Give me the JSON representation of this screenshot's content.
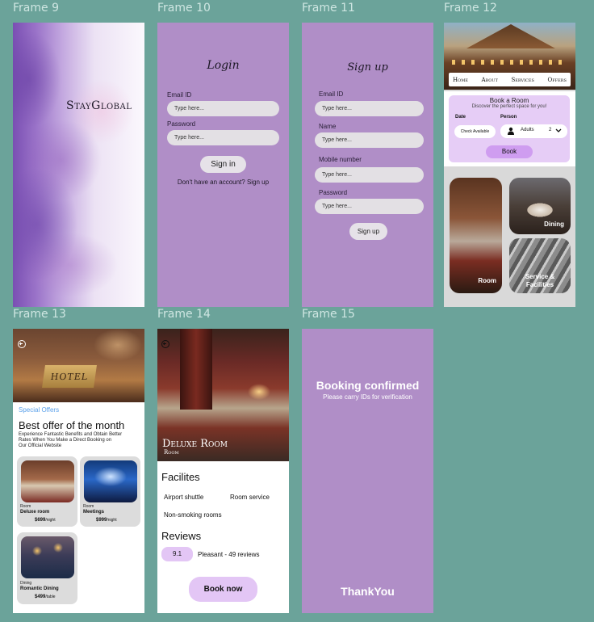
{
  "frames": {
    "f9": "Frame 9",
    "f10": "Frame 10",
    "f11": "Frame 11",
    "f12": "Frame 12",
    "f13": "Frame 13",
    "f14": "Frame 14",
    "f15": "Frame 15"
  },
  "splash": {
    "brand": "StayGlobal"
  },
  "login": {
    "title": "Login",
    "email_label": "Email ID",
    "email_placeholder": "Type here...",
    "password_label": "Password",
    "password_placeholder": "Type here...",
    "signin_button": "Sign in",
    "signup_prompt": "Don't have an account? Sign up"
  },
  "signup": {
    "title": "Sign up",
    "email_label": "Email ID",
    "email_placeholder": "Type here...",
    "name_label": "Name",
    "name_placeholder": "Type here...",
    "mobile_label": "Mobile number",
    "mobile_placeholder": "Type here...",
    "password_label": "Password",
    "password_placeholder": "Type here...",
    "signup_button": "Sign up"
  },
  "home": {
    "nav": [
      "Home",
      "About",
      "Services",
      "Offers"
    ],
    "book_title": "Book a Room",
    "book_subtitle": "Discover the perfect space for you!",
    "date_label": "Date",
    "person_label": "Person",
    "check_button": "Check Available",
    "adults_label": "Adults",
    "adults_count": "2",
    "book_button": "Book",
    "tiles": {
      "room": "Room",
      "dining": "Dining",
      "service_line1": "Service &",
      "service_line2": "Facilities"
    }
  },
  "offers": {
    "hero_sign": "HOTEL",
    "tag": "Special Offers",
    "headline": "Best offer of the month",
    "desc_line1": "Experience Fantastic Benefits and Obtain Better",
    "desc_line2": "Rates When You Make a Direct Booking on",
    "desc_line3": "Our Official Website",
    "cards": [
      {
        "category": "Room",
        "name": "Deluxe room",
        "price": "$699",
        "unit": "/night"
      },
      {
        "category": "Room",
        "name": "Meetings",
        "price": "$999",
        "unit": "/night"
      },
      {
        "category": "Dining",
        "name": "Romantic Dining",
        "price": "$499",
        "unit": "/table"
      }
    ]
  },
  "detail": {
    "room_title": "Deluxe Room",
    "room_sub": "Room",
    "facilities_heading": "Facilites",
    "facilities": [
      "Airport shuttle",
      "Room service",
      "Non-smoking rooms"
    ],
    "reviews_heading": "Reviews",
    "score": "9.1",
    "score_text": "Pleasant - 49 reviews",
    "book_now": "Book now"
  },
  "confirm": {
    "title": "Booking confirmed",
    "subtitle": "Please carry  IDs for verification",
    "thanks": "ThankYou"
  }
}
